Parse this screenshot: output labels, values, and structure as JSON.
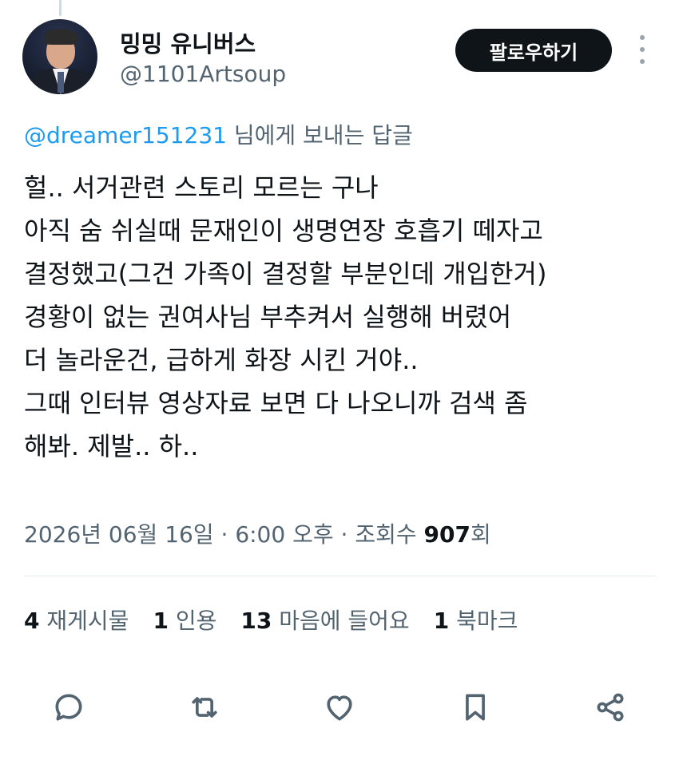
{
  "author": {
    "display_name": "밍밍 유니버스",
    "handle": "@1101Artsoup"
  },
  "header": {
    "follow_label": "팔로우하기"
  },
  "reply": {
    "mention": "@dreamer151231",
    "suffix": " 님에게 보내는 답글"
  },
  "tweet": {
    "lines": [
      "헐.. 서거관련 스토리 모르는 구나",
      "아직 숨 쉬실때 문재인이 생명연장 호흡기 떼자고",
      "결정했고(그건 가족이 결정할 부분인데 개입한거)",
      "경황이 없는 권여사님 부추켜서 실행해 버렸어",
      "더 놀라운건, 급하게 화장 시킨 거야..",
      "그때 인터뷰 영상자료 보면 다 나오니까 검색 좀",
      "해봐. 제발.. 하.."
    ]
  },
  "meta": {
    "date": "2026년 06월 16일",
    "sep1": " · ",
    "time": "6:00 오후",
    "sep2": " · ",
    "views_label": "조회수 ",
    "views_count": "907",
    "views_suffix": "회"
  },
  "stats": {
    "retweets": {
      "count": "4",
      "label": "재게시물"
    },
    "quotes": {
      "count": "1",
      "label": "인용"
    },
    "likes": {
      "count": "13",
      "label": "마음에 들어요"
    },
    "bookmarks": {
      "count": "1",
      "label": "북마크"
    }
  },
  "icons": {
    "reply": "reply-icon",
    "retweet": "retweet-icon",
    "like": "heart-icon",
    "bookmark": "bookmark-icon",
    "share": "share-icon",
    "more": "more-icon"
  },
  "colors": {
    "mention": "#1d9bf0",
    "secondary_text": "#536471",
    "follow_button_bg": "#0f1419"
  }
}
